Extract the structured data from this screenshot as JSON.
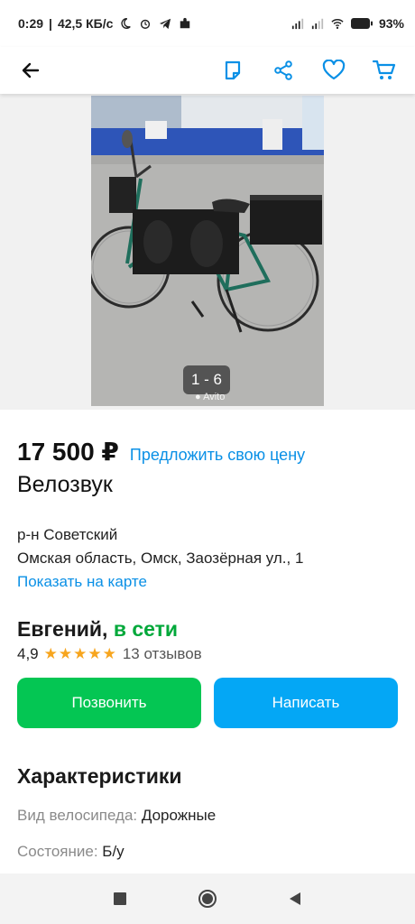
{
  "status": {
    "time": "0:29",
    "net_speed": "42,5 КБ/с",
    "battery": "93"
  },
  "gallery": {
    "counter": "1 - 6",
    "watermark": "Avito"
  },
  "listing": {
    "price": "17 500 ₽",
    "offer_link": "Предложить свою цену",
    "title": "Велозвук",
    "district": "р-н Советский",
    "address": "Омская область, Омск, Заозёрная ул., 1",
    "map_link": "Показать на карте"
  },
  "seller": {
    "name": "Евгений,",
    "online": "в сети",
    "rating": "4,9",
    "stars": "★★★★★",
    "reviews": "13 отзывов"
  },
  "actions": {
    "call": "Позвонить",
    "write": "Написать"
  },
  "specs": {
    "heading": "Характеристики",
    "items": [
      {
        "key": "Вид велосипеда:",
        "value": "Дорожные"
      },
      {
        "key": "Состояние:",
        "value": "Б/у"
      }
    ]
  },
  "colors": {
    "link_blue": "#0a90e6",
    "call_green": "#04c653",
    "write_blue": "#04a7f5",
    "online_green": "#00a83a",
    "star_orange": "#f7a51e"
  }
}
